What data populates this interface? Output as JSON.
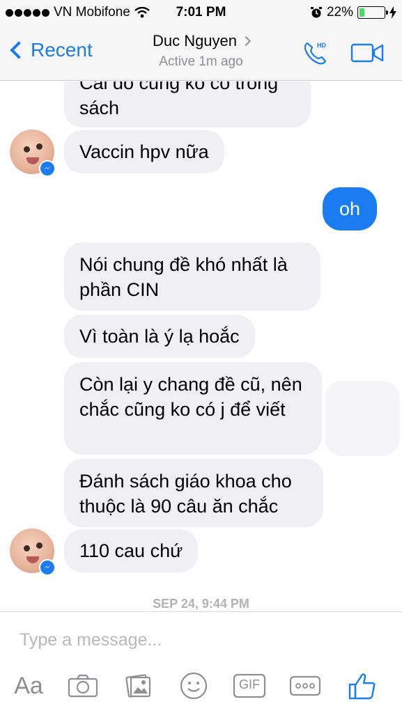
{
  "status_bar": {
    "carrier": "VN Mobifone",
    "time": "7:01 PM",
    "battery_percent": "22%",
    "battery_level": 0.22,
    "icons": [
      "signal-dots-icon",
      "wifi-icon",
      "alarm-icon",
      "battery-icon",
      "charging-icon"
    ]
  },
  "header": {
    "back_label": "Recent",
    "contact_name": "Duc Nguyen",
    "active_status": "Active 1m ago",
    "icons": [
      "hd-phone-icon",
      "video-call-icon"
    ]
  },
  "messages": [
    {
      "sender": "them",
      "text": "Cái đó cũng ko có trong sách"
    },
    {
      "sender": "them",
      "text": "Vaccin hpv nữa"
    },
    {
      "sender": "me",
      "text": "oh"
    },
    {
      "sender": "them",
      "text": "Nói chung đề khó nhất là phần CIN"
    },
    {
      "sender": "them",
      "text": "Vì toàn là ý lạ hoắc"
    },
    {
      "sender": "them",
      "text": "Còn lại y chang đề cũ, nên chắc cũng ko có j để viết"
    },
    {
      "sender": "them",
      "text": "Đánh sách giáo khoa cho thuộc là 90 câu ăn chắc"
    },
    {
      "sender": "them",
      "text": "110 cau chứ"
    }
  ],
  "timestamp": "SEP 24, 9:44 PM",
  "composer": {
    "placeholder": "Type a message...",
    "aa_label": "Aa",
    "gif_label": "GIF",
    "icons": [
      "camera-icon",
      "photo-gallery-icon",
      "emoji-icon",
      "gif-icon",
      "more-icon",
      "like-icon"
    ]
  },
  "colors": {
    "accent": "#1a7cf0",
    "received_bubble": "#efeff4",
    "sent_bubble": "#1a7cf0",
    "muted": "#8e8e93"
  }
}
